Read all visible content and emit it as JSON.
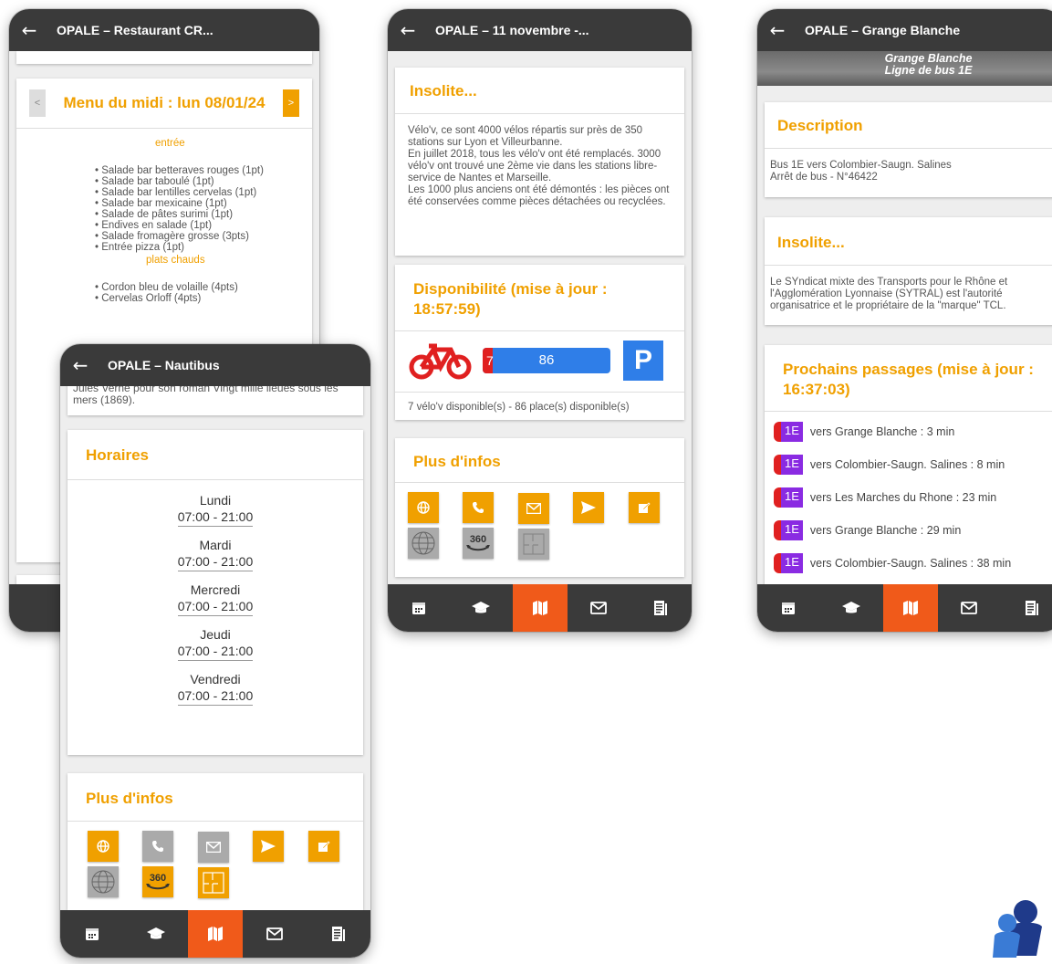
{
  "phone1": {
    "title": "OPALE – Restaurant CR...",
    "menu_title": "Menu du midi : lun 08/01/24",
    "prev_label": "<",
    "next_label": ">",
    "entree_heading": "entrée",
    "entree_items": [
      "• Salade bar betteraves rouges (1pt)",
      "• Salade bar taboulé (1pt)",
      "• Salade bar lentilles cervelas (1pt)",
      "• Salade bar mexicaine (1pt)",
      "• Salade de pâtes surimi (1pt)",
      "• Endives en salade (1pt)",
      "• Salade fromagère grosse (3pts)",
      "• Entrée pizza (1pt)"
    ],
    "plats_heading": "plats chauds",
    "plats_items": [
      "• Cordon bleu de volaille (4pts)",
      "• Cervelas Orloff (4pts)"
    ]
  },
  "phone2": {
    "title": "OPALE – 11 novembre -...",
    "insolite_title": "Insolite...",
    "insolite_text": "Vélo'v, ce sont 4000 vélos répartis sur près de 350 stations sur Lyon et Villeurbanne.\nEn juillet 2018, tous les vélo'v ont été remplacés. 3000 vélo'v ont trouvé une 2ème vie dans les stations libre-service de Nantes et Marseille.\nLes 1000 plus anciens ont été démontés : les pièces ont été conservées comme pièces détachées ou recyclées.",
    "dispo_title": "Disponibilité (mise à jour : 18:57:59)",
    "bikes_available": "7",
    "places_available": "86",
    "bikes_fraction": 0.075,
    "parking_label": "P",
    "dispo_text": "7 vélo'v disponible(s) - 86 place(s) disponible(s)",
    "infos_title": "Plus d'infos"
  },
  "phone3": {
    "title": "OPALE – Grange Blanche",
    "banner_line1": "Grange Blanche",
    "banner_line2": "Ligne de bus 1E",
    "desc_title": "Description",
    "desc_text": "Bus 1E vers Colombier-Saugn. Salines\nArrêt de bus - N°46422",
    "insolite_title": "Insolite...",
    "insolite_text": "Le SYndicat mixte des Transports pour le Rhône et l'Agglomération Lyonnaise (SYTRAL) est l'autorité organisatrice et le propriétaire de la \"marque\" TCL.",
    "passages_title": "Prochains passages (mise à jour : 16:37:03)",
    "passages": [
      {
        "line": "1E",
        "text": "vers Grange Blanche : 3 min"
      },
      {
        "line": "1E",
        "text": "vers Colombier-Saugn. Salines : 8 min"
      },
      {
        "line": "1E",
        "text": "vers Les Marches du Rhone : 23 min"
      },
      {
        "line": "1E",
        "text": "vers Grange Blanche : 29 min"
      },
      {
        "line": "1E",
        "text": "vers Colombier-Saugn. Salines : 38 min"
      }
    ]
  },
  "phone4": {
    "title": "OPALE – Nautibus",
    "top_text": "Jules Verne pour son roman Vingt mille lieues sous les mers (1869).",
    "horaires_title": "Horaires",
    "schedule": [
      {
        "day": "Lundi",
        "time": "07:00 - 21:00"
      },
      {
        "day": "Mardi",
        "time": "07:00 - 21:00"
      },
      {
        "day": "Mercredi",
        "time": "07:00 - 21:00"
      },
      {
        "day": "Jeudi",
        "time": "07:00 - 21:00"
      },
      {
        "day": "Vendredi",
        "time": "07:00 - 21:00"
      }
    ],
    "infos_title": "Plus d'infos"
  },
  "colors": {
    "accent": "#f0a000",
    "appbar": "#3a3a3a",
    "nav_active": "#f05a1a",
    "grey_button": "#aaaaaa",
    "bike_red": "#e02020",
    "bar_blue": "#2f7ee8",
    "line_purple": "#8a2be2"
  },
  "icons": {
    "nav": [
      "calendar-icon",
      "graduation-cap-icon",
      "map-icon",
      "mail-icon",
      "news-icon"
    ],
    "infos": [
      "globe-icon",
      "phone-icon",
      "mail-icon",
      "send-icon",
      "edit-icon",
      "www-globe-icon",
      "view-360-icon",
      "floor-plan-icon"
    ]
  }
}
